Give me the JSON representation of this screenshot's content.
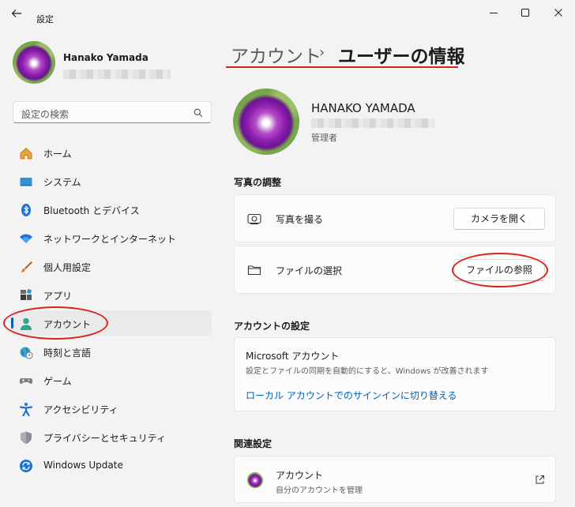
{
  "window": {
    "title": "設定"
  },
  "sidebar": {
    "user_name": "Hanako Yamada",
    "search_placeholder": "設定の検索",
    "items": [
      {
        "label": "ホーム",
        "icon": "home-icon"
      },
      {
        "label": "システム",
        "icon": "system-icon"
      },
      {
        "label": "Bluetooth とデバイス",
        "icon": "bluetooth-icon"
      },
      {
        "label": "ネットワークとインターネット",
        "icon": "wifi-icon"
      },
      {
        "label": "個人用設定",
        "icon": "brush-icon"
      },
      {
        "label": "アプリ",
        "icon": "apps-icon"
      },
      {
        "label": "アカウント",
        "icon": "account-icon",
        "active": true
      },
      {
        "label": "時刻と言語",
        "icon": "globe-clock-icon"
      },
      {
        "label": "ゲーム",
        "icon": "gamepad-icon"
      },
      {
        "label": "アクセシビリティ",
        "icon": "accessibility-icon"
      },
      {
        "label": "プライバシーとセキュリティ",
        "icon": "shield-icon"
      },
      {
        "label": "Windows Update",
        "icon": "update-icon"
      }
    ]
  },
  "breadcrumb": {
    "parent": "アカウント",
    "separator": "›",
    "current": "ユーザーの情報"
  },
  "profile": {
    "name": "HANAKO YAMADA",
    "role": "管理者"
  },
  "photo_section": {
    "title": "写真の調整",
    "take_photo_label": "写真を撮る",
    "open_camera_button": "カメラを開く",
    "choose_file_label": "ファイルの選択",
    "browse_button": "ファイルの参照"
  },
  "account_settings": {
    "title": "アカウントの設定",
    "ms_account_title": "Microsoft アカウント",
    "ms_account_desc": "設定とファイルの同期を自動的にすると、Windows が改善されます",
    "switch_link": "ローカル アカウントでのサインインに切り替える"
  },
  "related": {
    "title": "関連設定",
    "item_title": "アカウント",
    "item_subtitle": "自分のアカウントを管理"
  },
  "colors": {
    "accent": "#005fb8",
    "annotation_red": "#d9231f"
  }
}
